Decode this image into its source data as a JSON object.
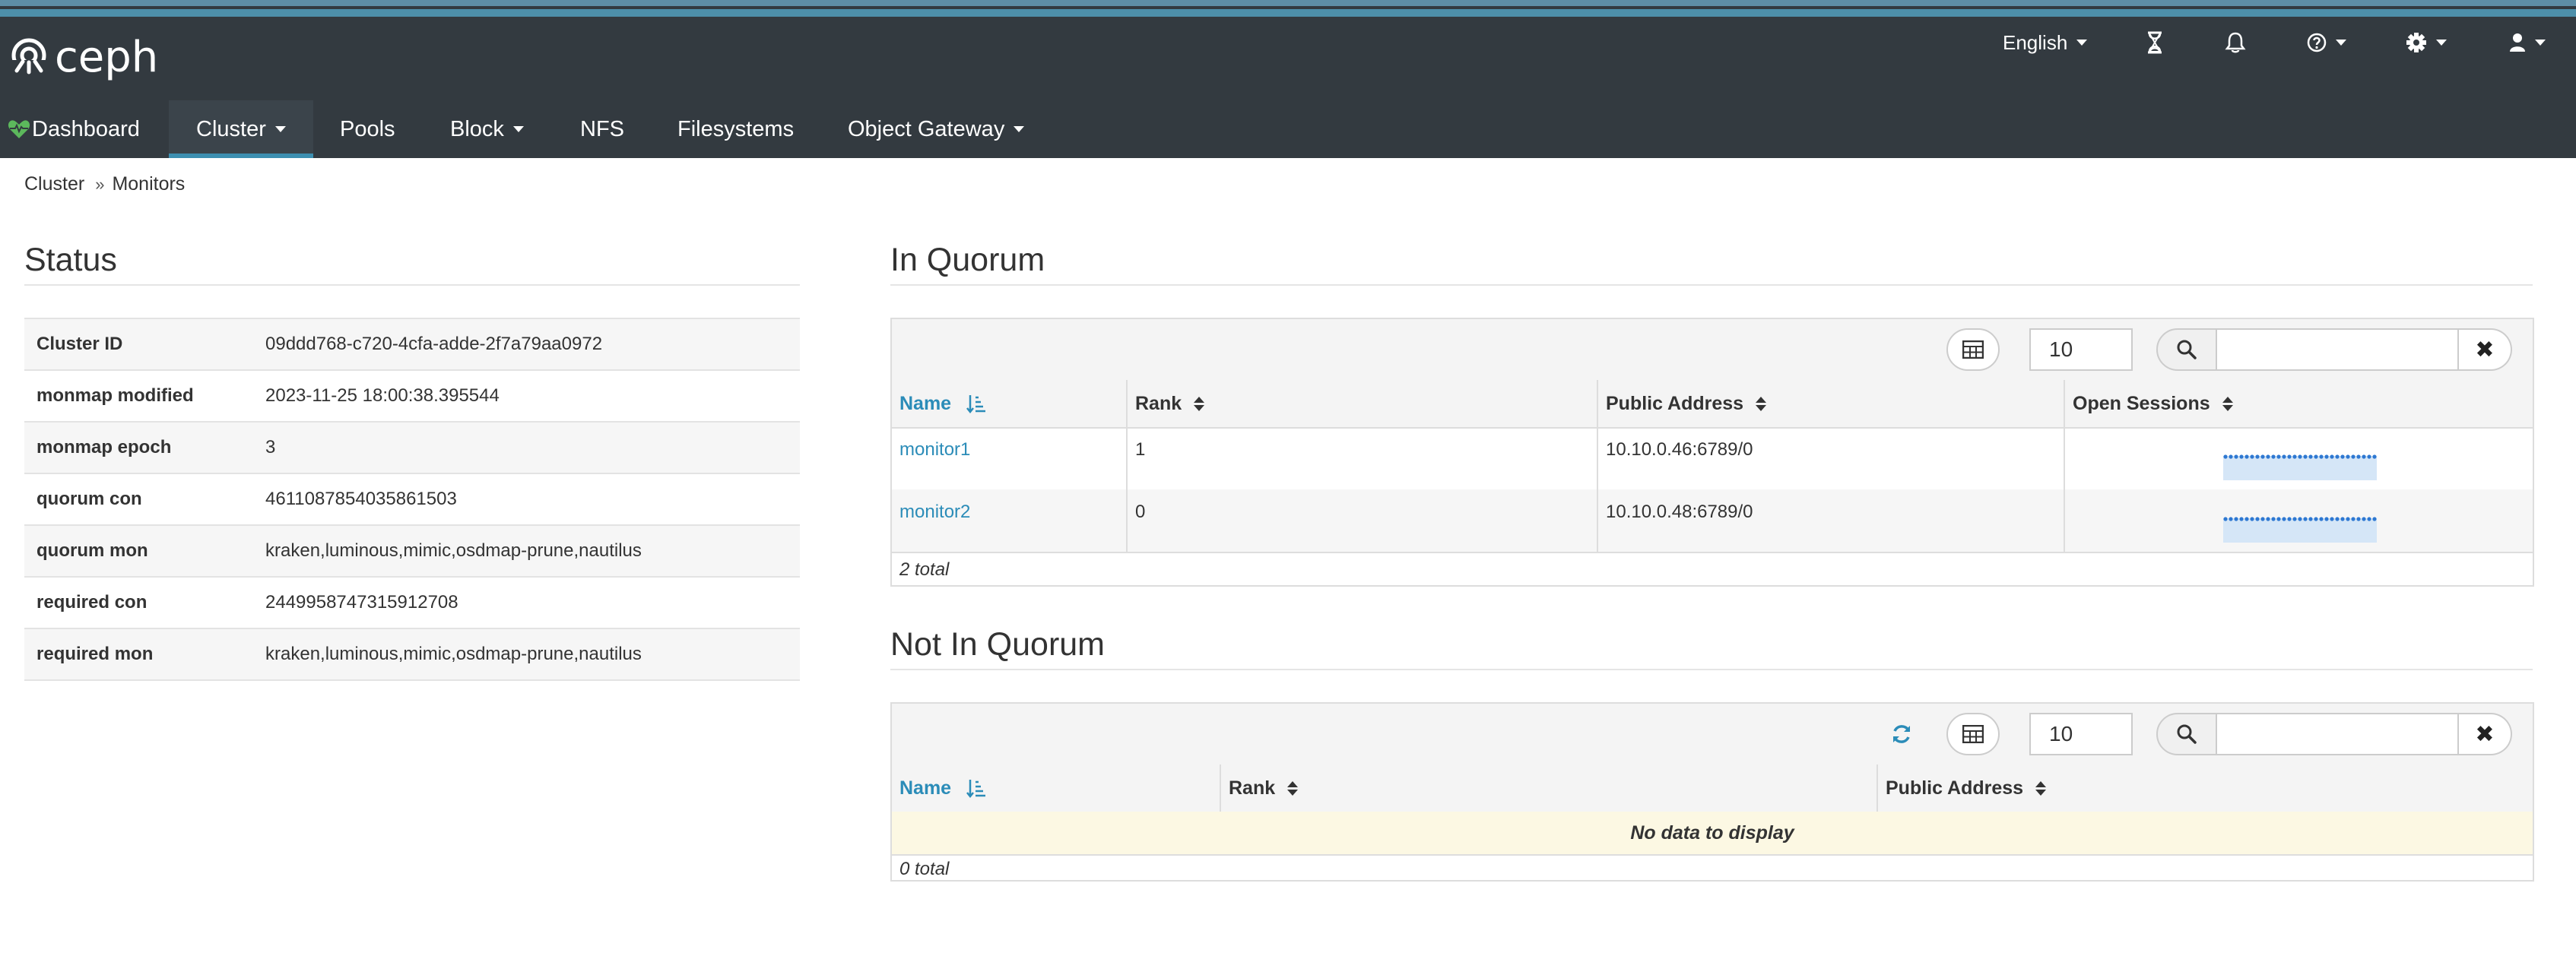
{
  "app": {
    "logo_text": "ceph",
    "language": "English",
    "icons": {
      "logo": "ceph-logo-icon",
      "tasks": "hourglass-icon",
      "notifications": "bell-icon",
      "help": "question-circle-icon",
      "settings": "gear-icon",
      "user": "user-icon"
    }
  },
  "nav": {
    "items": [
      {
        "label": "Dashboard",
        "icon": "heartbeat-icon"
      },
      {
        "label": "Cluster",
        "dropdown": true,
        "active": true
      },
      {
        "label": "Pools"
      },
      {
        "label": "Block",
        "dropdown": true
      },
      {
        "label": "NFS"
      },
      {
        "label": "Filesystems"
      },
      {
        "label": "Object Gateway",
        "dropdown": true
      }
    ]
  },
  "breadcrumb": {
    "items": [
      "Cluster",
      "Monitors"
    ]
  },
  "status": {
    "title": "Status",
    "rows": [
      {
        "key": "Cluster ID",
        "value": "09ddd768-c720-4cfa-adde-2f7a79aa0972"
      },
      {
        "key": "monmap modified",
        "value": "2023-11-25 18:00:38.395544"
      },
      {
        "key": "monmap epoch",
        "value": "3"
      },
      {
        "key": "quorum con",
        "value": "4611087854035861503"
      },
      {
        "key": "quorum mon",
        "value": "kraken,luminous,mimic,osdmap-prune,nautilus"
      },
      {
        "key": "required con",
        "value": "2449958747315912708"
      },
      {
        "key": "required mon",
        "value": "kraken,luminous,mimic,osdmap-prune,nautilus"
      }
    ]
  },
  "in_quorum": {
    "title": "In Quorum",
    "page_size": "10",
    "search_value": "",
    "columns": [
      "Name",
      "Rank",
      "Public Address",
      "Open Sessions"
    ],
    "rows": [
      {
        "name": "monitor1",
        "rank": "1",
        "public_address": "10.10.0.46:6789/0"
      },
      {
        "name": "monitor2",
        "rank": "0",
        "public_address": "10.10.0.48:6789/0"
      }
    ],
    "footer": "2 total"
  },
  "not_in_quorum": {
    "title": "Not In Quorum",
    "page_size": "10",
    "search_value": "",
    "columns": [
      "Name",
      "Rank",
      "Public Address"
    ],
    "empty_message": "No data to display",
    "footer": "0 total"
  },
  "colors": {
    "navbar": "#333a40",
    "accent": "#2b8cb8",
    "link": "#2b8cb8",
    "empty_row": "#fcf8e3"
  }
}
